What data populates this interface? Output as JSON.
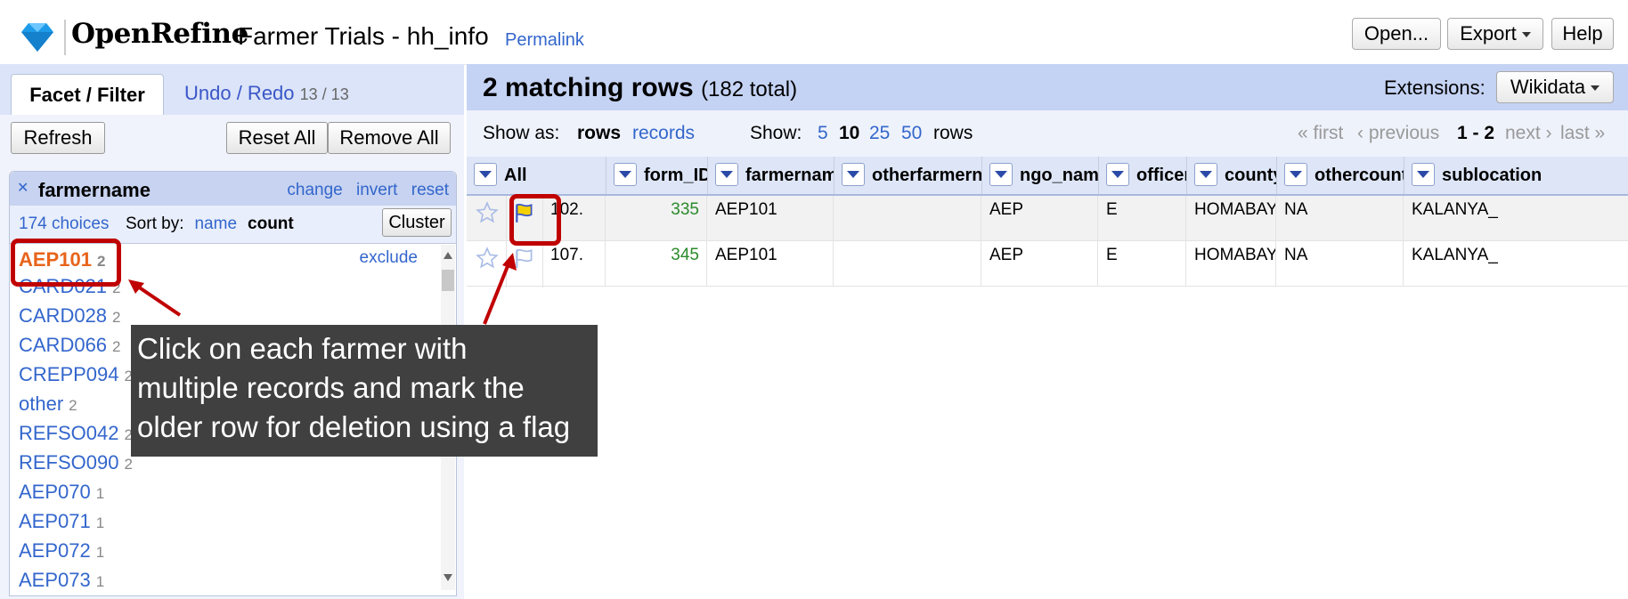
{
  "app": {
    "brand": "OpenRefine",
    "project_name": "Farmer Trials - hh_info",
    "permalink": "Permalink",
    "buttons": {
      "open": "Open...",
      "export": "Export",
      "help": "Help"
    }
  },
  "left_panel": {
    "tabs": {
      "facet": "Facet / Filter",
      "undo": "Undo / Redo",
      "undo_count": "13 / 13"
    },
    "buttons": {
      "refresh": "Refresh",
      "reset_all": "Reset All",
      "remove_all": "Remove All"
    },
    "facet": {
      "name": "farmername",
      "links": [
        "change",
        "invert",
        "reset"
      ],
      "choices": "174 choices",
      "sort_by_label": "Sort by:",
      "sort_name": "name",
      "sort_count": "count",
      "cluster": "Cluster",
      "exclude": "exclude",
      "items": [
        {
          "label": "AEP101",
          "count": "2",
          "selected": true
        },
        {
          "label": "CARD021",
          "count": "2"
        },
        {
          "label": "CARD028",
          "count": "2"
        },
        {
          "label": "CARD066",
          "count": "2"
        },
        {
          "label": "CREPP094",
          "count": "2"
        },
        {
          "label": "other",
          "count": "2"
        },
        {
          "label": "REFSO042",
          "count": "2"
        },
        {
          "label": "REFSO090",
          "count": "2"
        },
        {
          "label": "AEP070",
          "count": "1"
        },
        {
          "label": "AEP071",
          "count": "1"
        },
        {
          "label": "AEP072",
          "count": "1"
        },
        {
          "label": "AEP073",
          "count": "1"
        }
      ]
    }
  },
  "right_panel": {
    "matching": "2 matching rows",
    "total": "(182 total)",
    "extensions_label": "Extensions:",
    "extensions_value": "Wikidata",
    "show_as_label": "Show as:",
    "show_rows": "rows",
    "show_records": "records",
    "show_label": "Show:",
    "page_sizes": [
      "5",
      "10",
      "25",
      "50"
    ],
    "rows_word": "rows",
    "pager": {
      "first": "« first",
      "previous": "‹ previous",
      "range": "1 - 2",
      "next": "next ›",
      "last": "last »"
    },
    "columns": [
      "All",
      "form_ID",
      "farmername",
      "otherfarmername",
      "ngo_name",
      "officer",
      "county",
      "othercounty",
      "sublocation"
    ],
    "rows": [
      {
        "index": "102.",
        "form_ID": "335",
        "farmername": "AEP101",
        "otherfarmername": "",
        "ngo_name": "AEP",
        "officer": "E",
        "county": "HOMABAY",
        "othercounty": "NA",
        "sublocation": "KALANYA_",
        "flagged": true
      },
      {
        "index": "107.",
        "form_ID": "345",
        "farmername": "AEP101",
        "otherfarmername": "",
        "ngo_name": "AEP",
        "officer": "E",
        "county": "HOMABAY",
        "othercounty": "NA",
        "sublocation": "KALANYA_",
        "flagged": false
      }
    ]
  },
  "annotation": {
    "text_lines": [
      "Click on each farmer with",
      "multiple records and mark the",
      "older row for deletion using a flag"
    ],
    "color": "#c00000"
  }
}
